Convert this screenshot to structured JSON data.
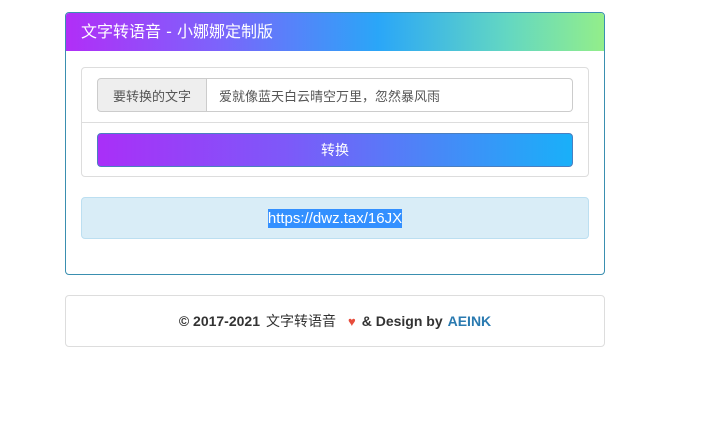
{
  "header": {
    "title": "文字转语音 - 小娜娜定制版"
  },
  "form": {
    "label": "要转换的文字",
    "input_value": "爱就像蓝天白云晴空万里，忽然暴风雨",
    "convert_label": "转换"
  },
  "result": {
    "link_text": "https://dwz.tax/16JX"
  },
  "footer": {
    "copyright": "© 2017-2021",
    "app_name": "文字转语音",
    "heart": "♥",
    "design_text": "& Design by",
    "brand": "AEINK"
  },
  "colors": {
    "heading_gradient": [
      "#b12ef7",
      "#2aa6f8",
      "#93ee8a"
    ],
    "button_gradient": [
      "#a92ff8",
      "#19b0f9"
    ],
    "result_bg": "#d9edf7",
    "heart": "#e74c3c",
    "brand": "#2a7ab0"
  }
}
